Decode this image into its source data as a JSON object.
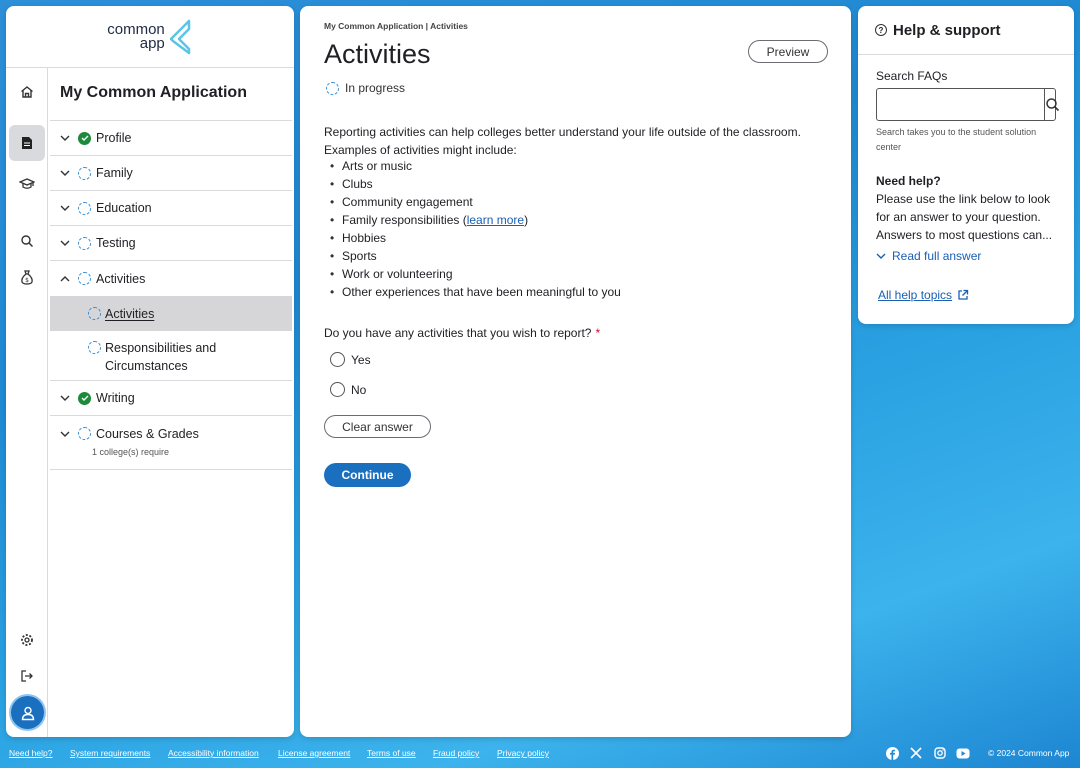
{
  "brand": {
    "line1": "common",
    "line2": "app"
  },
  "nav": {
    "title": "My Common Application",
    "items": [
      {
        "label": "Profile",
        "status": "complete",
        "expanded": false
      },
      {
        "label": "Family",
        "status": "in-progress",
        "expanded": false
      },
      {
        "label": "Education",
        "status": "in-progress",
        "expanded": false
      },
      {
        "label": "Testing",
        "status": "in-progress",
        "expanded": false
      },
      {
        "label": "Activities",
        "status": "in-progress",
        "expanded": true,
        "sub": [
          {
            "label": "Activities",
            "selected": true
          },
          {
            "label_line1": "Responsibilities and",
            "label_line2": "Circumstances"
          }
        ]
      },
      {
        "label": "Writing",
        "status": "complete",
        "expanded": false
      },
      {
        "label": "Courses & Grades",
        "status": "in-progress",
        "expanded": false,
        "note": "1 college(s) require"
      }
    ]
  },
  "rail": {
    "icons": [
      "home-icon",
      "document-icon",
      "graduation-cap-icon",
      "search-icon",
      "money-bag-icon",
      "gear-icon",
      "logout-icon",
      "user-icon"
    ],
    "active": "document-icon"
  },
  "main": {
    "breadcrumb": "My Common Application | Activities",
    "title": "Activities",
    "preview_label": "Preview",
    "status": "In progress",
    "intro_line1": "Reporting activities can help colleges better understand your life outside of the classroom.",
    "intro_line2": "Examples of activities might include:",
    "bullets": [
      "Arts or music",
      "Clubs",
      "Community engagement",
      "Family responsibilities (",
      "Hobbies",
      "Sports",
      "Work or volunteering",
      "Other experiences that have been meaningful to you"
    ],
    "learn_more": "learn more",
    "learn_more_close": ")",
    "question": "Do you have any activities that you wish to report?",
    "required_mark": "*",
    "options": [
      "Yes",
      "No"
    ],
    "clear_label": "Clear answer",
    "continue_label": "Continue"
  },
  "help": {
    "title": "Help & support",
    "faq_label": "Search FAQs",
    "faq_placeholder": "",
    "faq_note": "Search takes you to the student solution center",
    "need_help_title": "Need help?",
    "need_help_body": "Please use the link below to look for an answer to your question. Answers to most questions can...",
    "read_full": "Read full answer",
    "all_topics": "All help topics"
  },
  "footer": {
    "links": [
      "Need help?",
      "System requirements",
      "Accessibility information",
      "License agreement",
      "Terms of use",
      "Fraud policy",
      "Privacy policy"
    ],
    "social": [
      "facebook-icon",
      "x-icon",
      "instagram-icon",
      "youtube-icon"
    ],
    "copyright": "© 2024 Common App"
  },
  "colors": {
    "accent": "#1a6fbf",
    "complete": "#1b8a3a",
    "required": "#c8102e",
    "link": "#1a5fb4"
  }
}
